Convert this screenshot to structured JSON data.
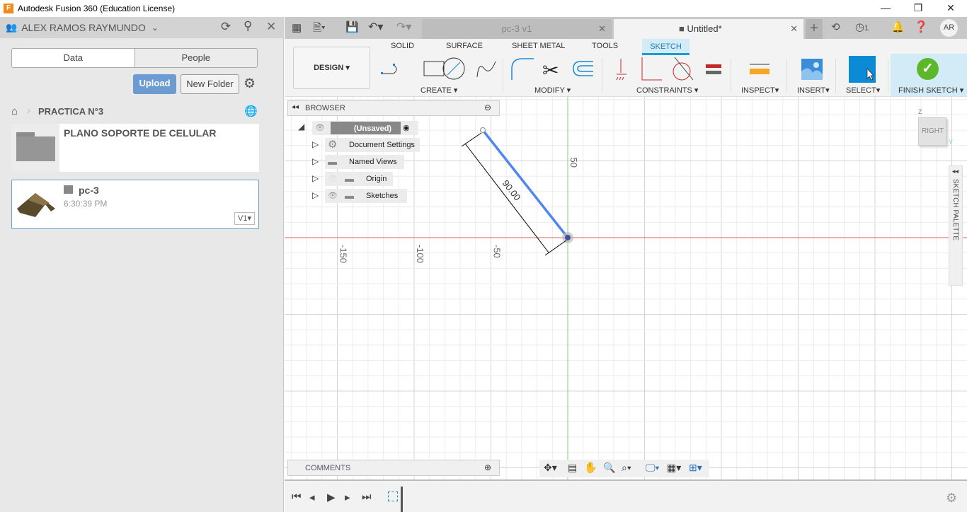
{
  "window": {
    "title": "Autodesk Fusion 360 (Education License)",
    "logo": "F"
  },
  "left_panel": {
    "user": "ALEX RAMOS RAYMUNDO",
    "tabs": [
      "Data",
      "People"
    ],
    "upload_label": "Upload",
    "new_folder_label": "New Folder",
    "breadcrumb": "PRACTICA N°3",
    "items": [
      {
        "name": "PLANO SOPORTE DE CELULAR",
        "type": "folder"
      },
      {
        "name": "pc-3",
        "time": "6:30:39 PM",
        "version": "V1"
      }
    ]
  },
  "tabs": [
    {
      "label": "pc-3 v1",
      "active": false
    },
    {
      "label": "Untitled*",
      "active": true
    }
  ],
  "top_right": {
    "jobs_count": "1",
    "avatar": "AR"
  },
  "ribbon": {
    "workspace": "DESIGN",
    "tabs": [
      "SOLID",
      "SURFACE",
      "SHEET METAL",
      "TOOLS",
      "SKETCH"
    ],
    "active_tab": "SKETCH",
    "groups": [
      "CREATE",
      "MODIFY",
      "CONSTRAINTS",
      "INSPECT",
      "INSERT",
      "SELECT",
      "FINISH SKETCH"
    ]
  },
  "browser": {
    "title": "BROWSER",
    "root": "(Unsaved)",
    "nodes": [
      "Document Settings",
      "Named Views",
      "Origin",
      "Sketches"
    ]
  },
  "comments": {
    "title": "COMMENTS"
  },
  "sketch_palette": {
    "label": "SKETCH PALETTE"
  },
  "viewcube": {
    "face": "RIGHT",
    "axis_z": "Z",
    "axis_y": "Y"
  },
  "canvas": {
    "axis_labels": [
      "-150",
      "-100",
      "-50",
      "50"
    ],
    "dimension": "90.00",
    "colors": {
      "x_axis": "#e06060",
      "y_axis": "#7ad67a",
      "line": "#4f86f0"
    }
  }
}
